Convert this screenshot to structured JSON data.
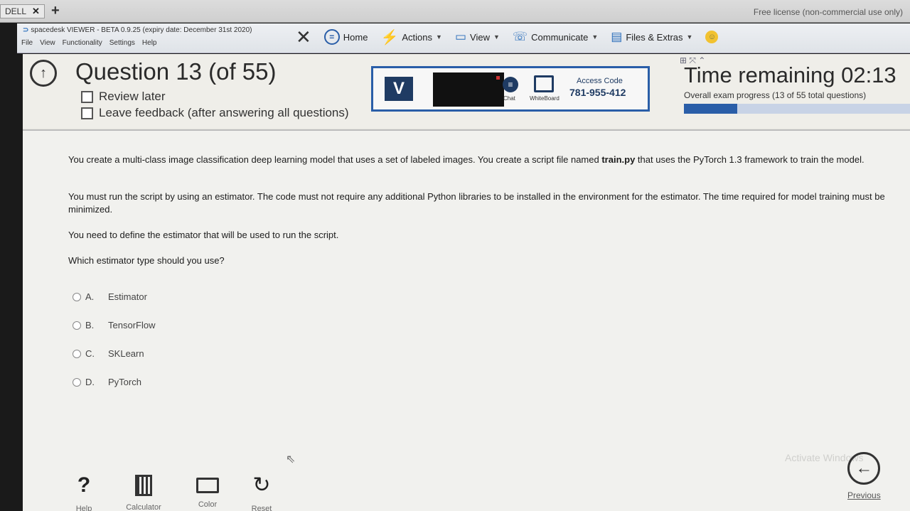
{
  "tabbar": {
    "tab_label": "DELL",
    "close": "✕",
    "add": "+",
    "license": "Free license (non-commercial use only)"
  },
  "viewer": {
    "title": "spacedesk VIEWER - BETA 0.9.25 (expiry date: December 31st 2020)",
    "menu": [
      "File",
      "View",
      "Functionality",
      "Settings",
      "Help"
    ],
    "toolbar": {
      "close": "✕",
      "home": "Home",
      "actions": "Actions",
      "view": "View",
      "communicate": "Communicate",
      "files": "Files & Extras"
    }
  },
  "exam": {
    "question_title": "Question 13 (of 55)",
    "review_later": "Review later",
    "leave_feedback": "Leave feedback (after answering all questions)",
    "remote": {
      "v": "V",
      "chat": "Chat",
      "whiteboard": "WhiteBoard",
      "access_label": "Access Code",
      "access_code": "781-955-412"
    },
    "time_remaining": "Time remaining  02:13",
    "progress_text": "Overall exam progress (13 of 55 total questions)",
    "progress_fraction": 0.236,
    "question": {
      "p1_pre": "You create a multi-class image classification deep learning model that uses a set of labeled images. You create a script file named ",
      "p1_bold": "train.py",
      "p1_post": " that uses the PyTorch 1.3 framework to train the model.",
      "p2": "You must run the script by using an estimator. The code must not require any additional Python libraries to be installed in the environment for the estimator. The time required for model training must be minimized.",
      "p3": "You need to define the estimator that will be used to run the script.",
      "p4": "Which estimator type should you use?"
    },
    "answers": [
      {
        "letter": "A.",
        "text": "Estimator"
      },
      {
        "letter": "B.",
        "text": "TensorFlow"
      },
      {
        "letter": "C.",
        "text": "SKLearn"
      },
      {
        "letter": "D.",
        "text": "PyTorch"
      }
    ],
    "tools": {
      "help_label": "Help",
      "calculator_label": "Calculator",
      "color_label": "Color",
      "reset_label": "Reset"
    },
    "previous": "Previous",
    "watermark": "Activate Windows"
  }
}
